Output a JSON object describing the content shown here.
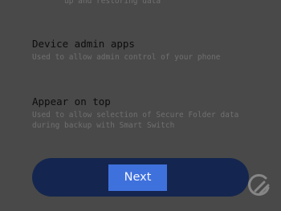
{
  "top_desc_fragment": "up and restoring data",
  "permissions": [
    {
      "title": "Device admin apps",
      "desc": "Used to allow admin control of your phone"
    },
    {
      "title": "Appear on top",
      "desc": "Used to allow selection of Secure Folder data during backup with Smart Switch"
    }
  ],
  "next_label": "Next",
  "watermark_icon": "gadgets-logo-icon",
  "colors": {
    "background": "#494949",
    "bottom_bar": "#14264f",
    "next_button": "#3f71dd"
  }
}
